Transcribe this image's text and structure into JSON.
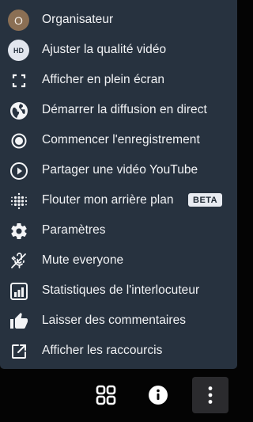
{
  "menu": {
    "items": [
      {
        "label": "Organisateur",
        "icon": "avatar",
        "avatar_letter": "O"
      },
      {
        "label": "Ajuster la qualité vidéo",
        "icon": "hd-icon",
        "icon_text": "HD"
      },
      {
        "label": "Afficher en plein écran",
        "icon": "fullscreen-icon"
      },
      {
        "label": "Démarrer la diffusion en direct",
        "icon": "globe-icon"
      },
      {
        "label": "Commencer l'enregistrement",
        "icon": "record-icon"
      },
      {
        "label": "Partager une vidéo YouTube",
        "icon": "play-circle-icon"
      },
      {
        "label": "Flouter mon arrière plan",
        "icon": "blur-icon",
        "badge": "BETA"
      },
      {
        "label": "Paramètres",
        "icon": "gear-icon"
      },
      {
        "label": "Mute everyone",
        "icon": "mic-off-icon"
      },
      {
        "label": "Statistiques de l'interlocuteur",
        "icon": "stats-icon"
      },
      {
        "label": "Laisser des commentaires",
        "icon": "thumbs-up-icon"
      },
      {
        "label": "Afficher les raccourcis",
        "icon": "open-in-new-icon"
      }
    ]
  },
  "toolbar": {
    "buttons": [
      {
        "icon": "grid-view-icon",
        "active": false
      },
      {
        "icon": "info-icon",
        "active": false
      },
      {
        "icon": "more-vertical-icon",
        "active": true
      }
    ]
  },
  "colors": {
    "menu_background": "#27323f",
    "page_background": "#040404",
    "text": "#f2f3f5",
    "avatar": "#8b6f54"
  }
}
